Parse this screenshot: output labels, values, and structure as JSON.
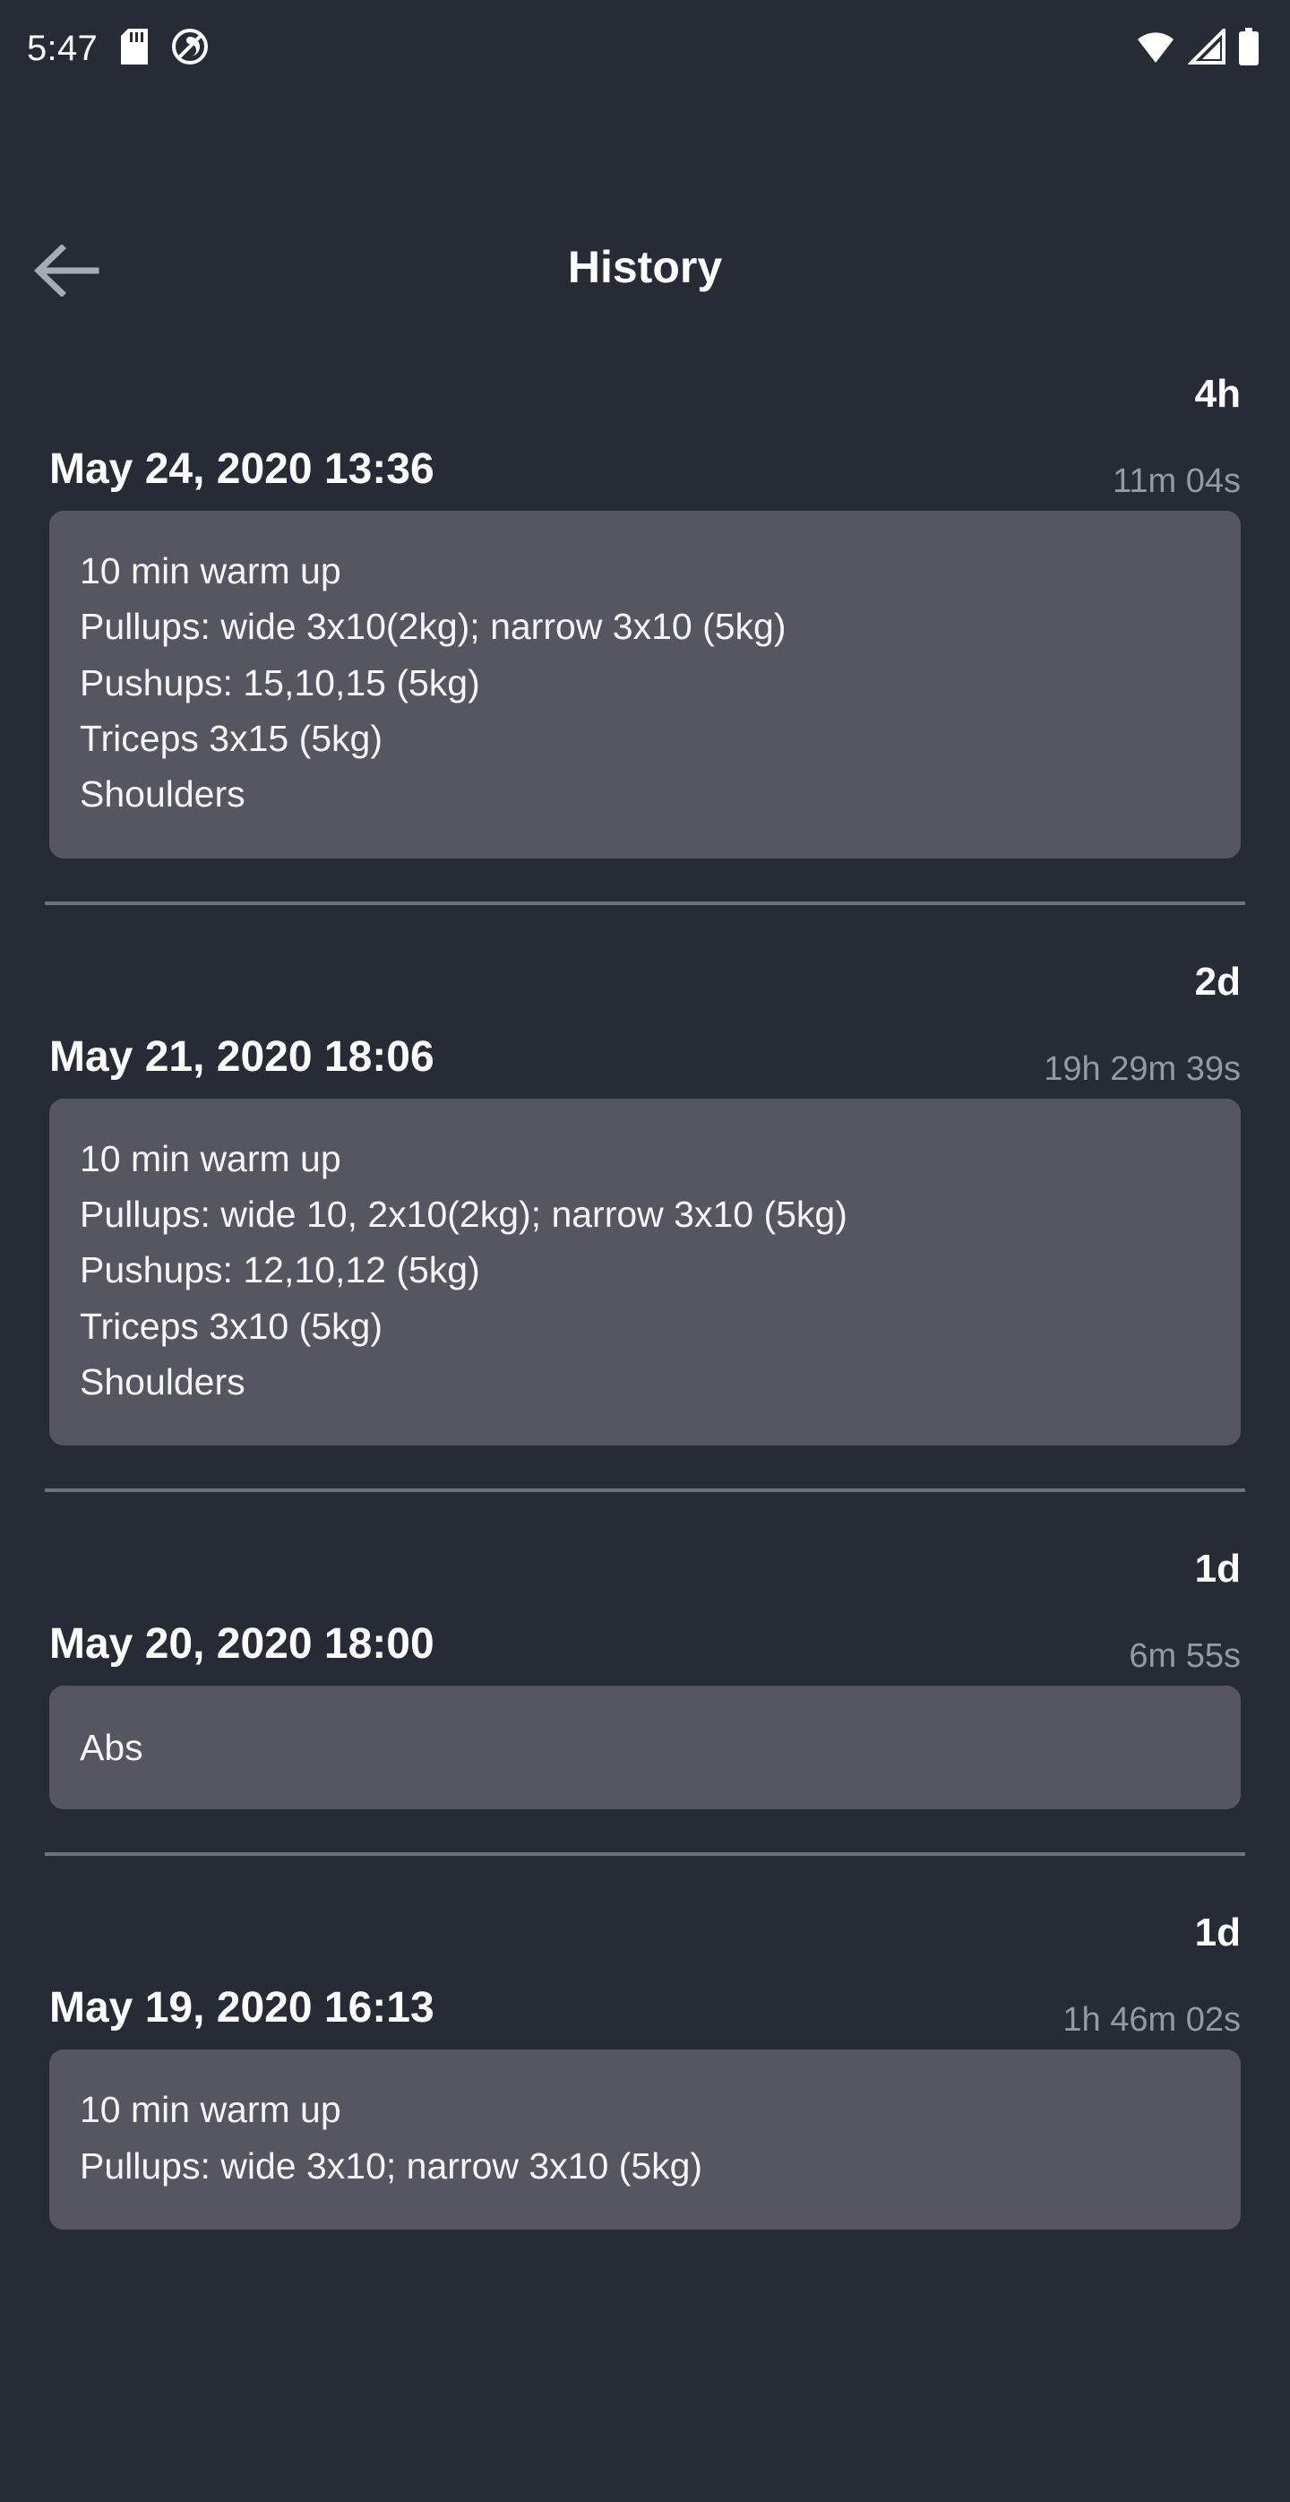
{
  "status_bar": {
    "clock": "5:47",
    "icons": [
      "sd-card-icon",
      "do-not-disturb-icon",
      "wifi-icon",
      "cell-signal-icon",
      "battery-icon"
    ]
  },
  "app_bar": {
    "back_icon": "back-arrow-icon",
    "title": "History"
  },
  "colors": {
    "page_bg": "#272b35",
    "card_bg": "#55565f",
    "primary_text": "#ffffff",
    "secondary_text": "#9399a5",
    "divider": "#6e727d"
  },
  "entries": [
    {
      "date": "May 24, 2020 13:36",
      "ago": "4h",
      "duration": "11m 04s",
      "lines": [
        "10 min warm up",
        "Pullups: wide 3x10(2kg); narrow 3x10 (5kg)",
        "Pushups: 15,10,15 (5kg)",
        "Triceps 3x15 (5kg)",
        "Shoulders"
      ]
    },
    {
      "date": "May 21, 2020 18:06",
      "ago": "2d",
      "duration": "19h 29m 39s",
      "lines": [
        "10 min warm up",
        "Pullups: wide 10, 2x10(2kg); narrow 3x10 (5kg)",
        "Pushups: 12,10,12 (5kg)",
        "Triceps 3x10 (5kg)",
        "Shoulders"
      ]
    },
    {
      "date": "May 20, 2020 18:00",
      "ago": "1d",
      "duration": "6m 55s",
      "lines": [
        "Abs"
      ]
    },
    {
      "date": "May 19, 2020 16:13",
      "ago": "1d",
      "duration": "1h 46m 02s",
      "lines": [
        "10 min warm up",
        "Pullups: wide 3x10; narrow 3x10 (5kg)"
      ]
    }
  ]
}
